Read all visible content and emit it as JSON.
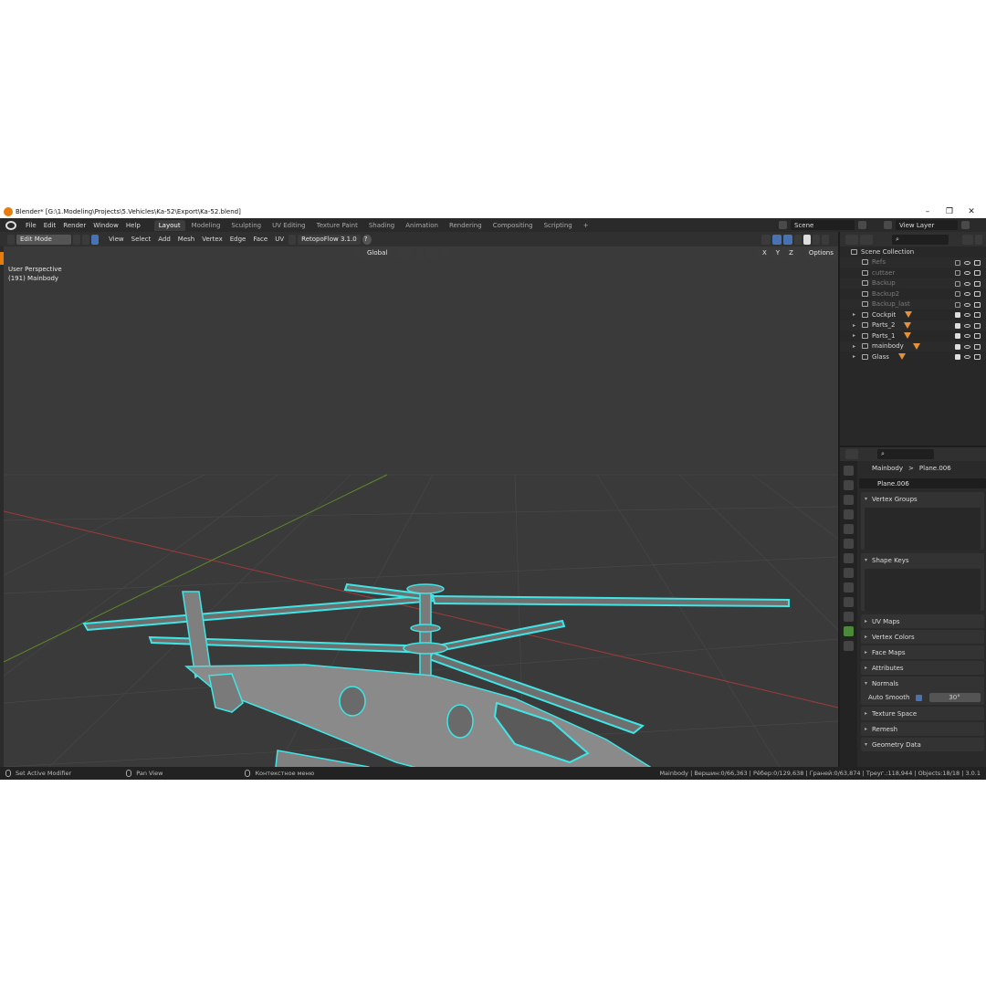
{
  "window": {
    "title": "Blender* [G:\\1.Modeling\\Projects\\5.Vehicles\\Ka-52\\Export\\Ka-52.blend]"
  },
  "menubar": {
    "items": [
      "File",
      "Edit",
      "Render",
      "Window",
      "Help"
    ],
    "workspaces": [
      "Layout",
      "Modeling",
      "Sculpting",
      "UV Editing",
      "Texture Paint",
      "Shading",
      "Animation",
      "Rendering",
      "Compositing",
      "Scripting"
    ],
    "active_workspace": "Layout",
    "add_tab": "+",
    "scene": "Scene",
    "view_layer": "View Layer"
  },
  "viewport_header": {
    "mode": "Edit Mode",
    "menus": [
      "View",
      "Select",
      "Add",
      "Mesh",
      "Vertex",
      "Edge",
      "Face",
      "UV"
    ],
    "addon": "RetopoFlow 3.1.0",
    "addon_help": "?",
    "transform_orientation": "Global",
    "axes": [
      "X",
      "Y",
      "Z"
    ],
    "options": "Options"
  },
  "viewport": {
    "view_name": "User Perspective",
    "object_info": "(191) Mainbody"
  },
  "outliner": {
    "root": "Scene Collection",
    "collections": [
      {
        "name": "Refs",
        "enabled": false
      },
      {
        "name": "cuttaer",
        "enabled": false
      },
      {
        "name": "Backup",
        "enabled": false
      },
      {
        "name": "Backup2",
        "enabled": false
      },
      {
        "name": "Backup_last",
        "enabled": false
      },
      {
        "name": "Cockpit",
        "enabled": true
      },
      {
        "name": "Parts_2",
        "enabled": true
      },
      {
        "name": "Parts_1",
        "enabled": true
      },
      {
        "name": "mainbody",
        "enabled": true
      },
      {
        "name": "Glass",
        "enabled": true
      }
    ]
  },
  "properties": {
    "breadcrumb_object": "Mainbody",
    "breadcrumb_sep": ">",
    "breadcrumb_data": "Plane.006",
    "data_name": "Plane.006",
    "panels": {
      "vertex_groups": "Vertex Groups",
      "shape_keys": "Shape Keys",
      "uv_maps": "UV Maps",
      "vertex_colors": "Vertex Colors",
      "face_maps": "Face Maps",
      "attributes": "Attributes",
      "normals": "Normals",
      "texture_space": "Texture Space",
      "remesh": "Remesh",
      "geometry_data": "Geometry Data"
    },
    "auto_smooth_label": "Auto Smooth",
    "auto_smooth_angle": "30°",
    "list_add": "+"
  },
  "statusbar": {
    "left_action": "Set Active Modifier",
    "middle_action": "Pan View",
    "right_action": "Контекстное меню",
    "stats": "Mainbody | Вершин:0/66,363 | Рёбер:0/129,638 | Граней:0/63,874 | Треуг.:118,944 | Objects:18/18 | 3.0.1"
  },
  "colors": {
    "wire_accent": "#3ee6e6",
    "mesh_body": "#8a8a8a",
    "active_blue": "#4772b3",
    "mesh_icon": "#e3913a"
  }
}
